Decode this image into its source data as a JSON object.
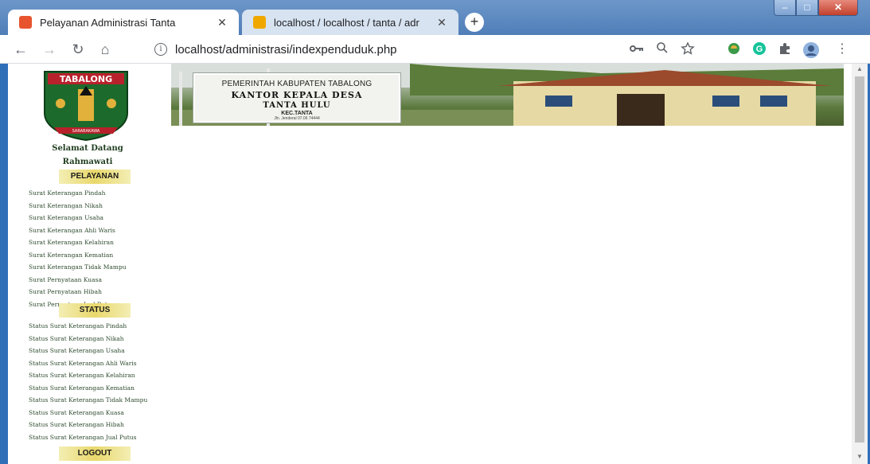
{
  "browser": {
    "tabs": [
      {
        "label": "Pelayanan Administrasi Tanta",
        "close": "✕",
        "favicon_color": "#e8542e"
      },
      {
        "label": "localhost / localhost / tanta / adr",
        "close": "✕",
        "favicon_color": "#f0a800"
      }
    ],
    "new_tab": "+",
    "window_controls": {
      "minimize": "–",
      "maximize": "□",
      "close": "✕"
    },
    "nav": {
      "back": "←",
      "forward": "→",
      "reload": "↻",
      "home": "⌂"
    },
    "url": "localhost/administrasi/indexpenduduk.php",
    "info": "i",
    "toolbar_icons": [
      "key-icon",
      "zoom-icon",
      "star-icon",
      "extension-icon",
      "grammarly-icon",
      "puzzle-icon",
      "profile-avatar",
      "menu-icon"
    ]
  },
  "header": {
    "logo_text": "TABALONG",
    "logo_ribbon": "SARABAKAWA",
    "sign": {
      "line1": "PEMERINTAH KABUPATEN TABALONG",
      "line2": "KANTOR KEPALA DESA",
      "line3": "TANTA HULU",
      "line4": "KEC.TANTA",
      "line5": "Jln. Jenderal 07.06 74444"
    }
  },
  "sidebar": {
    "greeting": "Selamat Datang",
    "username": "Rahmawati",
    "pelayanan_label": "PELAYANAN",
    "pelayanan_items": [
      "Surat Keterangan Pindah",
      "Surat Keterangan Nikah",
      "Surat Keterangan Usaha",
      "Surat Keterangan Ahli Waris",
      "Surat Keterangan Kelahiran",
      "Surat Keterangan Kematian",
      "Surat Keterangan Tidak Mampu",
      "Surat Pernyataan Kuasa",
      "Surat Pernyataan Hibah",
      "Surat Pernyataan Jual Putus"
    ],
    "status_label": "STATUS",
    "status_items": [
      "Status Surat Keterangan Pindah",
      "Status Surat Keterangan Nikah",
      "Status Surat Keterangan Usaha",
      "Status Surat Keterangan Ahli Waris",
      "Status Surat Keterangan Kelahiran",
      "Status Surat Keterangan Kematian",
      "Status Surat Keterangan Tidak Mampu",
      "Status Surat Keterangan Kuasa",
      "Status Surat Keterangan Hibah",
      "Status Surat Keterangan Jual Putus"
    ],
    "logout_label": "LOGOUT"
  },
  "colors": {
    "section_button": "#e9d86c",
    "link": "#2d4a2d",
    "titlebar": "#5f8ac0"
  }
}
